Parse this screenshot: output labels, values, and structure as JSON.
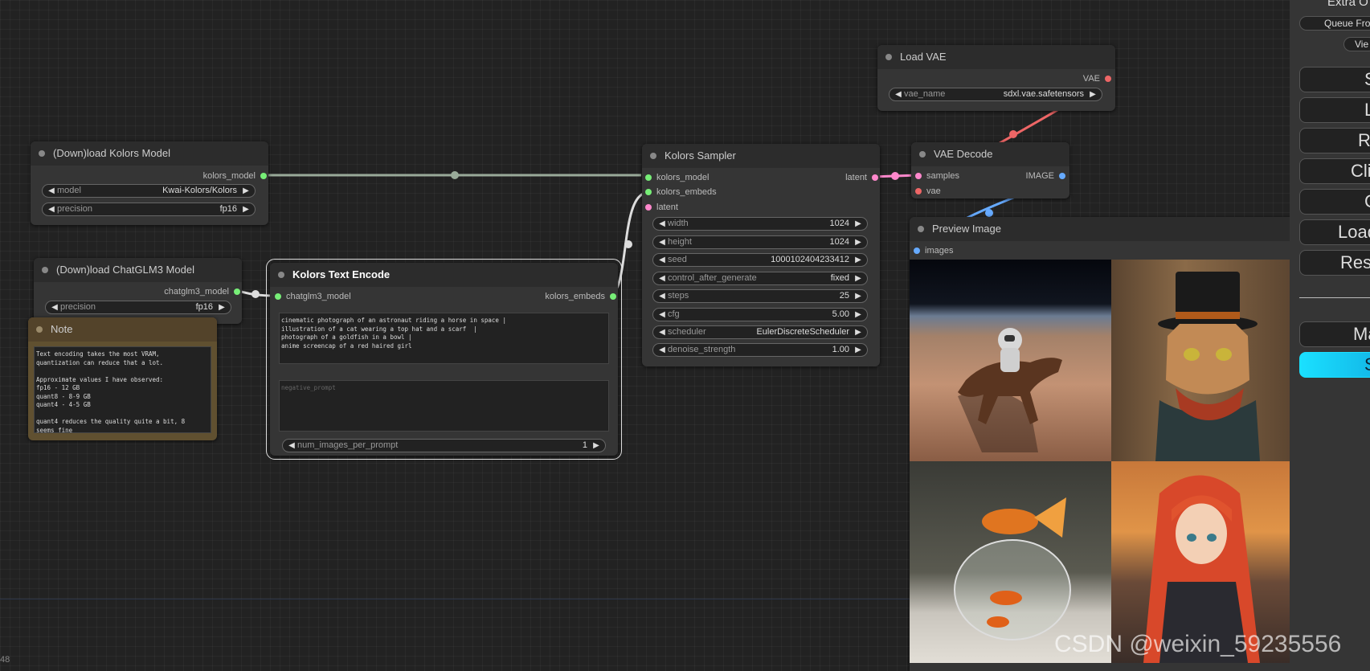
{
  "colors": {
    "kolors_model": "#9a9",
    "latent": "#f8c",
    "image": "#6af",
    "vae": "#e66",
    "model_slot": "#7e7",
    "accent": "#1ae0ff"
  },
  "nodes": {
    "download_kolors": {
      "title": "(Down)load Kolors Model",
      "out": "kolors_model",
      "model_label": "model",
      "model_value": "Kwai-Kolors/Kolors",
      "precision_label": "precision",
      "precision_value": "fp16"
    },
    "download_chatglm": {
      "title": "(Down)load ChatGLM3 Model",
      "out": "chatglm3_model",
      "precision_label": "precision",
      "precision_value": "fp16"
    },
    "note": {
      "title": "Note",
      "text": "Text encoding takes the most VRAM,\nquantization can reduce that a lot.\n\nApproximate values I have observed:\nfp16 - 12 GB\nquant8 - 8-9 GB\nquant4 - 4-5 GB\n\nquant4 reduces the quality quite a bit, 8\nseems fine"
    },
    "text_encode": {
      "title": "Kolors Text Encode",
      "in": "chatglm3_model",
      "out": "kolors_embeds",
      "prompt": "cinematic photograph of an astronaut riding a horse in space |\nillustration of a cat wearing a top hat and a scarf  |\nphotograph of a goldfish in a bowl |\nanime screencap of a red haired girl",
      "negative_placeholder": "negative_prompt",
      "num_label": "num_images_per_prompt",
      "num_value": "1"
    },
    "sampler": {
      "title": "Kolors Sampler",
      "inputs": [
        "kolors_model",
        "kolors_embeds",
        "latent"
      ],
      "out": "latent",
      "widgets": [
        {
          "label": "width",
          "value": "1024"
        },
        {
          "label": "height",
          "value": "1024"
        },
        {
          "label": "seed",
          "value": "1000102404233412"
        },
        {
          "label": "control_after_generate",
          "value": "fixed"
        },
        {
          "label": "steps",
          "value": "25"
        },
        {
          "label": "cfg",
          "value": "5.00"
        },
        {
          "label": "scheduler",
          "value": "EulerDiscreteScheduler"
        },
        {
          "label": "denoise_strength",
          "value": "1.00"
        }
      ]
    },
    "load_vae": {
      "title": "Load VAE",
      "out": "VAE",
      "vae_label": "vae_name",
      "vae_value": "sdxl.vae.safetensors"
    },
    "vae_decode": {
      "title": "VAE Decode",
      "in_samples": "samples",
      "in_vae": "vae",
      "out": "IMAGE"
    },
    "preview": {
      "title": "Preview Image",
      "in": "images"
    }
  },
  "menu": {
    "extra": "Extra O",
    "queue_front": "Queue Front",
    "view": "Vie",
    "buttons": [
      "S",
      "L",
      "Re",
      "Clip",
      "C",
      "Load",
      "Res"
    ],
    "manager": "Ma",
    "share": "S"
  },
  "watermark": "CSDN @weixin_59235556",
  "corner_text": "48"
}
